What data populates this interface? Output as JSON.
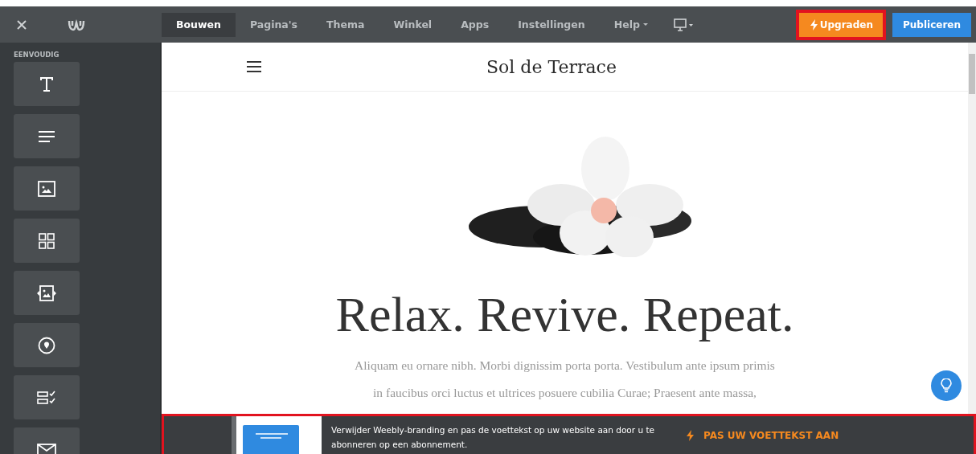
{
  "toolbar": {
    "tabs": [
      {
        "label": "Bouwen",
        "selected": true
      },
      {
        "label": "Pagina's",
        "selected": false
      },
      {
        "label": "Thema",
        "selected": false
      },
      {
        "label": "Winkel",
        "selected": false
      },
      {
        "label": "Apps",
        "selected": false
      },
      {
        "label": "Instellingen",
        "selected": false
      },
      {
        "label": "Help",
        "selected": false,
        "dropdown": true
      }
    ],
    "upgrade": {
      "label": "Upgraden",
      "highlighted": true
    },
    "publish": {
      "label": "Publiceren"
    }
  },
  "sidebar": {
    "section": "EENVOUDIG",
    "tiles": [
      {
        "kind": "title"
      },
      {
        "kind": "text"
      },
      {
        "kind": "image"
      },
      {
        "kind": "gallery"
      },
      {
        "kind": "slideshow"
      },
      {
        "kind": "map"
      },
      {
        "kind": "form"
      },
      {
        "kind": "mail"
      }
    ]
  },
  "site": {
    "title": "Sol de Terrace",
    "headline": "Relax. Revive. Repeat.",
    "body_lines": [
      "Aliquam eu ornare nibh. Morbi dignissim porta porta. Vestibulum ante ipsum primis",
      "in faucibus orci luctus et ultrices posuere cubilia Curae; Praesent ante massa,"
    ]
  },
  "banner": {
    "highlighted": true,
    "text": "Verwijder Weebly-branding en pas de voettekst op uw website aan door u te abonneren op een abonnement.",
    "link": "PAS UW VOETTEKST AAN"
  }
}
